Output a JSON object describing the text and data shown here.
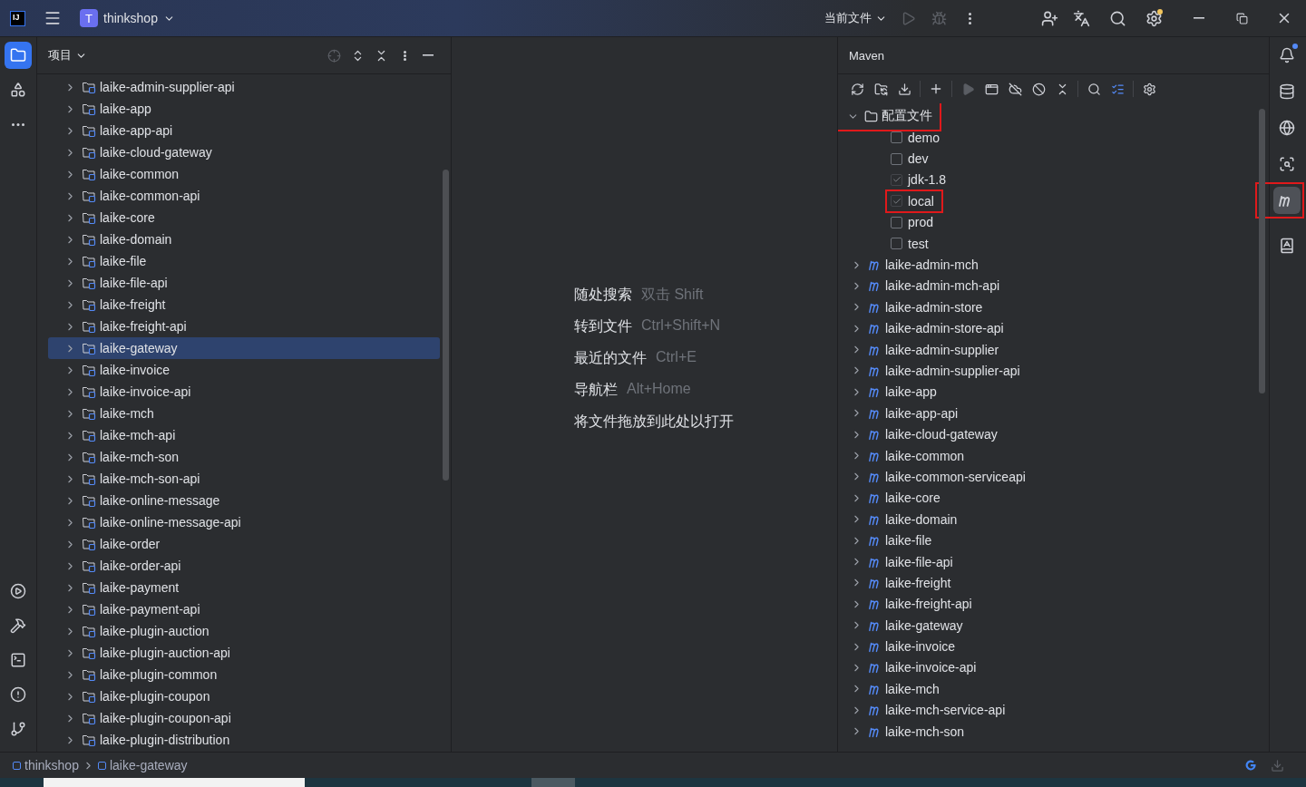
{
  "title_bar": {
    "logo": "IJ",
    "project_initial": "T",
    "project": "thinkshop",
    "run_config": "当前文件",
    "settings_badge": true
  },
  "left_tools": [
    {
      "kind": "folder",
      "selected": true
    },
    {
      "kind": "structure",
      "selected": false
    },
    {
      "kind": "more",
      "selected": false
    },
    {
      "kind": "run",
      "selected": false
    },
    {
      "kind": "build",
      "selected": false
    },
    {
      "kind": "terminal",
      "selected": false
    },
    {
      "kind": "problems",
      "selected": false
    },
    {
      "kind": "git",
      "selected": false
    }
  ],
  "project_panel": {
    "title": "项目",
    "items": [
      {
        "label": "laike-admin-supplier-api",
        "selected": false
      },
      {
        "label": "laike-app",
        "selected": false
      },
      {
        "label": "laike-app-api",
        "selected": false
      },
      {
        "label": "laike-cloud-gateway",
        "selected": false
      },
      {
        "label": "laike-common",
        "selected": false
      },
      {
        "label": "laike-common-api",
        "selected": false
      },
      {
        "label": "laike-core",
        "selected": false
      },
      {
        "label": "laike-domain",
        "selected": false
      },
      {
        "label": "laike-file",
        "selected": false
      },
      {
        "label": "laike-file-api",
        "selected": false
      },
      {
        "label": "laike-freight",
        "selected": false
      },
      {
        "label": "laike-freight-api",
        "selected": false
      },
      {
        "label": "laike-gateway",
        "selected": true
      },
      {
        "label": "laike-invoice",
        "selected": false
      },
      {
        "label": "laike-invoice-api",
        "selected": false
      },
      {
        "label": "laike-mch",
        "selected": false
      },
      {
        "label": "laike-mch-api",
        "selected": false
      },
      {
        "label": "laike-mch-son",
        "selected": false
      },
      {
        "label": "laike-mch-son-api",
        "selected": false
      },
      {
        "label": "laike-online-message",
        "selected": false
      },
      {
        "label": "laike-online-message-api",
        "selected": false
      },
      {
        "label": "laike-order",
        "selected": false
      },
      {
        "label": "laike-order-api",
        "selected": false
      },
      {
        "label": "laike-payment",
        "selected": false
      },
      {
        "label": "laike-payment-api",
        "selected": false
      },
      {
        "label": "laike-plugin-auction",
        "selected": false
      },
      {
        "label": "laike-plugin-auction-api",
        "selected": false
      },
      {
        "label": "laike-plugin-common",
        "selected": false
      },
      {
        "label": "laike-plugin-coupon",
        "selected": false
      },
      {
        "label": "laike-plugin-coupon-api",
        "selected": false
      },
      {
        "label": "laike-plugin-distribution",
        "selected": false
      }
    ]
  },
  "editor_hints": [
    {
      "action": "随处搜索",
      "shortcut": "双击 Shift"
    },
    {
      "action": "转到文件",
      "shortcut": "Ctrl+Shift+N"
    },
    {
      "action": "最近的文件",
      "shortcut": "Ctrl+E"
    },
    {
      "action": "导航栏",
      "shortcut": "Alt+Home"
    },
    {
      "action": "将文件拖放到此处以打开"
    }
  ],
  "maven_panel": {
    "title": "Maven",
    "profiles": {
      "label": "配置文件",
      "expanded": true,
      "highlighted": true,
      "children": [
        {
          "label": "demo",
          "checked": false,
          "highlighted": false
        },
        {
          "label": "dev",
          "checked": false,
          "highlighted": false
        },
        {
          "label": "jdk-1.8",
          "checked": true,
          "highlighted": false
        },
        {
          "label": "local",
          "checked": true,
          "highlighted": true
        },
        {
          "label": "prod",
          "checked": false,
          "highlighted": false
        },
        {
          "label": "test",
          "checked": false,
          "highlighted": false
        }
      ]
    },
    "modules": [
      "laike-admin-mch",
      "laike-admin-mch-api",
      "laike-admin-store",
      "laike-admin-store-api",
      "laike-admin-supplier",
      "laike-admin-supplier-api",
      "laike-app",
      "laike-app-api",
      "laike-cloud-gateway",
      "laike-common",
      "laike-common-serviceapi",
      "laike-core",
      "laike-domain",
      "laike-file",
      "laike-file-api",
      "laike-freight",
      "laike-freight-api",
      "laike-gateway",
      "laike-invoice",
      "laike-invoice-api",
      "laike-mch",
      "laike-mch-service-api",
      "laike-mch-son"
    ]
  },
  "right_tools": [
    {
      "kind": "notifications",
      "selected": false,
      "highlighted": false,
      "badge": true
    },
    {
      "kind": "database",
      "selected": false,
      "highlighted": false
    },
    {
      "kind": "web",
      "selected": false,
      "highlighted": false
    },
    {
      "kind": "d",
      "selected": false,
      "highlighted": false
    },
    {
      "kind": "maven",
      "selected": true,
      "highlighted": true
    },
    {
      "kind": "book",
      "selected": false,
      "highlighted": false
    }
  ],
  "breadcrumbs": [
    "thinkshop",
    "laike-gateway"
  ]
}
